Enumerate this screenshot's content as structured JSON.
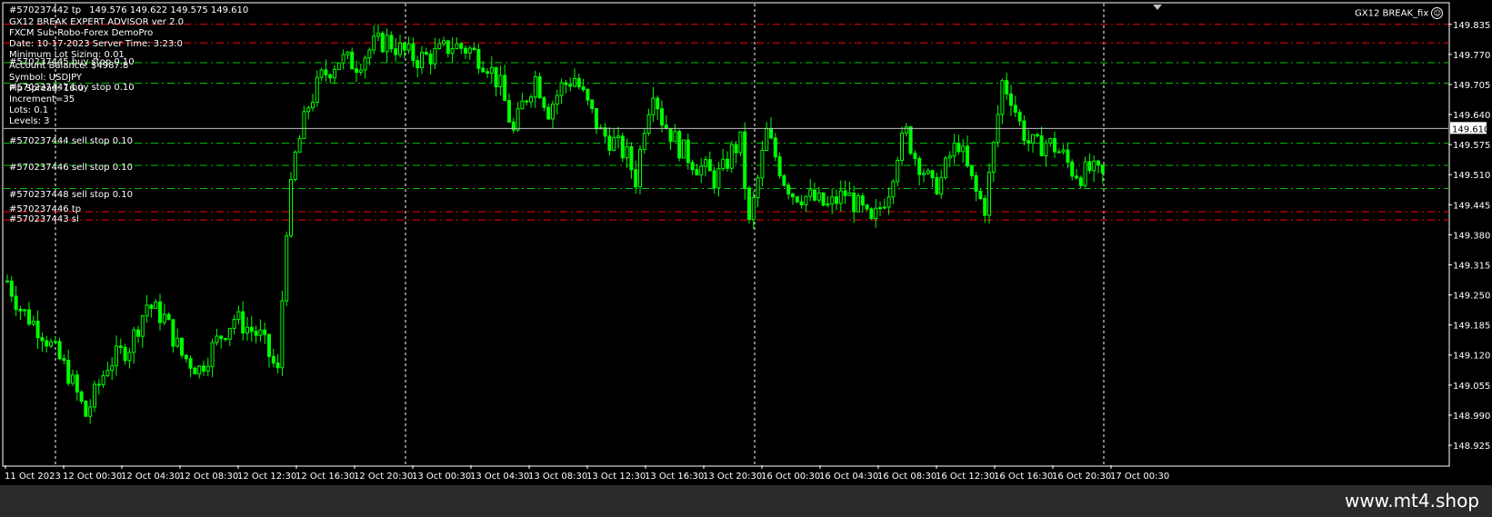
{
  "chart_header": {
    "symbol_label": "#570237442 tp",
    "ohlc": "149.576 149.622 149.575 149.610"
  },
  "ea_info": {
    "lines": [
      "GX12 BREAK EXPERT ADVISOR ver 2.0",
      "FXCM Sub-Robo-Forex DemoPro",
      "Date: 10-17-2023 Server Time: 3:23:0",
      "Minimum Lot Sizing: 0.01",
      "Account Balance: $4987.8",
      "Symbol: USDJPY",
      "Pip Spread: 16.0",
      "Increment=35",
      "Lots:  0.1",
      "Levels: 3"
    ]
  },
  "order_labels": [
    "#570237445 buy stop 0.10",
    "#570237447 buy stop 0.10",
    "#570237444 sell stop 0.10",
    "#570237446 sell stop 0.10",
    "#570237448 sell stop 0.10",
    "#570237446 tp",
    "#570237443 sl"
  ],
  "ea_name": "GX12 BREAK_fix",
  "ea_icon": "smiley-icon",
  "current_price": "149.610",
  "watermark": "www.mt4.shop",
  "colors": {
    "background": "#000000",
    "candle": "#00ff00",
    "order_line": "#00c800",
    "stop_line": "#ff0000",
    "grid": "#ffffff",
    "axis_text": "#ffffff",
    "price_box_bg": "#ffffff"
  },
  "chart_data": {
    "type": "candlestick",
    "y_ticks": [
      "149.835",
      "149.770",
      "149.705",
      "149.640",
      "149.575",
      "149.510",
      "149.445",
      "149.380",
      "149.315",
      "149.250",
      "149.185",
      "149.120",
      "149.055",
      "148.990",
      "148.925"
    ],
    "ylim": [
      148.925,
      149.868
    ],
    "x_ticks": [
      "11 Oct 2023",
      "12 Oct 00:30",
      "12 Oct 04:30",
      "12 Oct 08:30",
      "12 Oct 12:30",
      "12 Oct 16:30",
      "12 Oct 20:30",
      "13 Oct 00:30",
      "13 Oct 04:30",
      "13 Oct 08:30",
      "13 Oct 12:30",
      "13 Oct 16:30",
      "13 Oct 20:30",
      "16 Oct 00:30",
      "16 Oct 04:30",
      "16 Oct 08:30",
      "16 Oct 12:30",
      "16 Oct 16:30",
      "16 Oct 20:30",
      "17 Oct 00:30"
    ],
    "order_levels": [
      149.795,
      149.752,
      149.708,
      149.578,
      149.53,
      149.48,
      149.43,
      149.412
    ],
    "close_path": [
      [
        0,
        149.28
      ],
      [
        3,
        149.22
      ],
      [
        8,
        149.17
      ],
      [
        14,
        149.08
      ],
      [
        18,
        148.99
      ],
      [
        23,
        149.1
      ],
      [
        28,
        149.14
      ],
      [
        32,
        149.23
      ],
      [
        36,
        149.2
      ],
      [
        40,
        149.12
      ],
      [
        44,
        149.09
      ],
      [
        48,
        149.15
      ],
      [
        52,
        149.2
      ],
      [
        55,
        149.18
      ],
      [
        58,
        149.16
      ],
      [
        62,
        149.08
      ],
      [
        64,
        149.4
      ],
      [
        66,
        149.55
      ],
      [
        69,
        149.66
      ],
      [
        72,
        149.72
      ],
      [
        76,
        149.76
      ],
      [
        80,
        149.75
      ],
      [
        84,
        149.79
      ],
      [
        87,
        149.8
      ],
      [
        90,
        149.78
      ],
      [
        94,
        149.76
      ],
      [
        98,
        149.77
      ],
      [
        102,
        149.79
      ],
      [
        106,
        149.78
      ],
      [
        110,
        149.75
      ],
      [
        113,
        149.7
      ],
      [
        116,
        149.6
      ],
      [
        118,
        149.66
      ],
      [
        121,
        149.72
      ],
      [
        124,
        149.65
      ],
      [
        127,
        149.7
      ],
      [
        130,
        149.72
      ],
      [
        133,
        149.66
      ],
      [
        136,
        149.6
      ],
      [
        139,
        149.58
      ],
      [
        142,
        149.55
      ],
      [
        144,
        149.5
      ],
      [
        146,
        149.62
      ],
      [
        148,
        149.7
      ],
      [
        150,
        149.63
      ],
      [
        152,
        149.6
      ],
      [
        154,
        149.57
      ],
      [
        156,
        149.55
      ],
      [
        158,
        149.53
      ],
      [
        160,
        149.52
      ],
      [
        162,
        149.5
      ],
      [
        164,
        149.52
      ],
      [
        166,
        149.56
      ],
      [
        168,
        149.58
      ],
      [
        170,
        149.4
      ],
      [
        172,
        149.5
      ],
      [
        174,
        149.6
      ],
      [
        176,
        149.55
      ],
      [
        178,
        149.5
      ],
      [
        180,
        149.47
      ],
      [
        184,
        149.46
      ],
      [
        188,
        149.44
      ],
      [
        192,
        149.47
      ],
      [
        196,
        149.43
      ],
      [
        198,
        149.4
      ],
      [
        202,
        149.48
      ],
      [
        204,
        149.56
      ],
      [
        206,
        149.6
      ],
      [
        208,
        149.55
      ],
      [
        210,
        149.52
      ],
      [
        212,
        149.48
      ],
      [
        214,
        149.5
      ],
      [
        216,
        149.55
      ],
      [
        218,
        149.58
      ],
      [
        220,
        149.52
      ],
      [
        222,
        149.47
      ],
      [
        224,
        149.44
      ],
      [
        226,
        149.57
      ],
      [
        228,
        149.71
      ],
      [
        230,
        149.68
      ],
      [
        232,
        149.62
      ],
      [
        234,
        149.58
      ],
      [
        236,
        149.57
      ],
      [
        238,
        149.58
      ],
      [
        240,
        149.57
      ],
      [
        242,
        149.55
      ],
      [
        244,
        149.52
      ],
      [
        246,
        149.51
      ],
      [
        248,
        149.52
      ],
      [
        250,
        149.51
      ],
      [
        252,
        149.5
      ],
      [
        254,
        149.52
      ],
      [
        256,
        149.55
      ],
      [
        258,
        149.57
      ],
      [
        260,
        149.58
      ],
      [
        262,
        149.61
      ]
    ]
  }
}
